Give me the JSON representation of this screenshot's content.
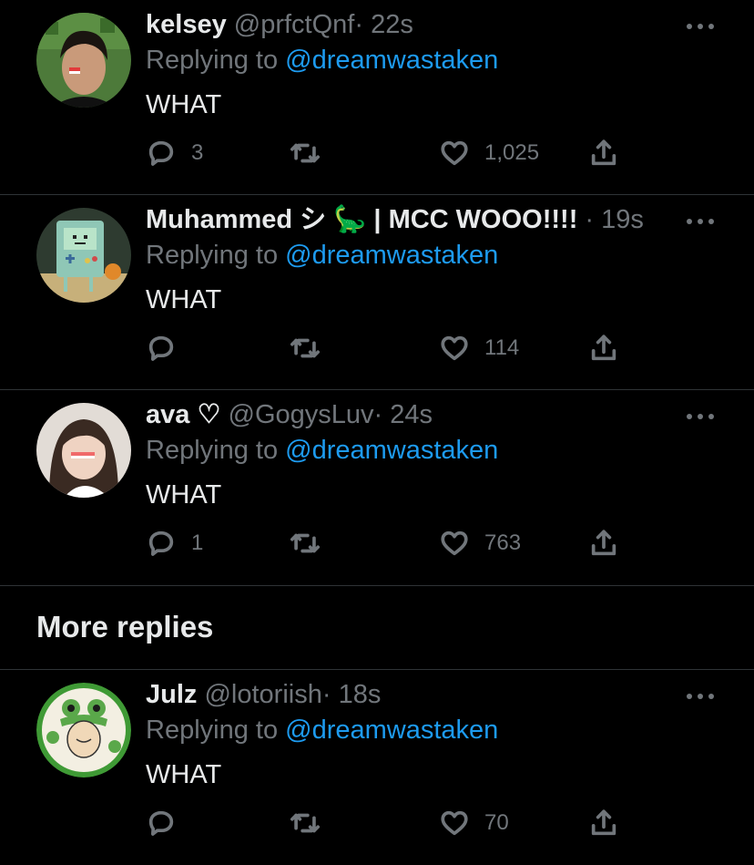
{
  "tweets": [
    {
      "name": "kelsey",
      "handle": "@prfctQnf",
      "time": "22s",
      "replying_prefix": "Replying to",
      "replying_to": "@dreamwastaken",
      "text": "WHAT",
      "replies": "3",
      "likes": "1,025",
      "avatar_color": "#3a5f2e"
    },
    {
      "name": "Muhammed シ 🦕 | MCC WOOO!!!!",
      "handle": "",
      "time": "19s",
      "replying_prefix": "Replying to",
      "replying_to": "@dreamwastaken",
      "text": "WHAT",
      "replies": "",
      "likes": "114",
      "avatar_color": "#8fbfae"
    },
    {
      "name": "ava ♡",
      "handle": "@GogysLuv",
      "time": "24s",
      "replying_prefix": "Replying to",
      "replying_to": "@dreamwastaken",
      "text": "WHAT",
      "replies": "1",
      "likes": "763",
      "avatar_color": "#d8cfc8"
    }
  ],
  "more_replies_title": "More replies",
  "more_tweets": [
    {
      "name": "Julz",
      "handle": "@lotoriish",
      "time": "18s",
      "replying_prefix": "Replying to",
      "replying_to": "@dreamwastaken",
      "text": "WHAT",
      "replies": "",
      "likes": "70",
      "avatar_color": "#4a9a3a"
    }
  ],
  "separator": "·",
  "colors": {
    "accent": "#1d9bf0",
    "muted": "#71767b",
    "background": "#000000"
  }
}
